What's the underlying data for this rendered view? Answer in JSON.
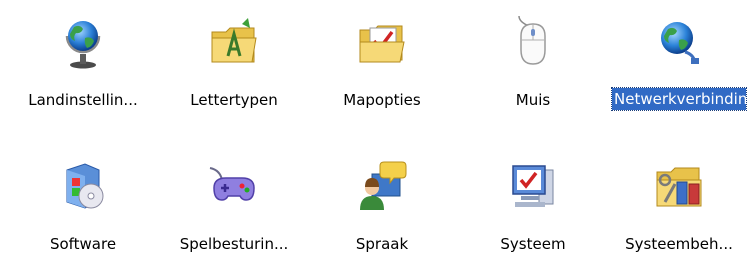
{
  "items": [
    {
      "label": "Landinstellin...",
      "icon": "globe-on-stand-icon"
    },
    {
      "label": "Lettertypen",
      "icon": "fonts-folder-icon"
    },
    {
      "label": "Mapopties",
      "icon": "folder-options-icon"
    },
    {
      "label": "Muis",
      "icon": "mouse-icon"
    },
    {
      "label": "Netwerkverbindingen",
      "icon": "network-globe-icon",
      "selected": true
    },
    {
      "label": "Software",
      "icon": "software-box-cd-icon"
    },
    {
      "label": "Spelbesturin...",
      "icon": "gamepad-icon"
    },
    {
      "label": "Spraak",
      "icon": "speech-person-icon"
    },
    {
      "label": "Systeem",
      "icon": "system-computer-icon"
    },
    {
      "label": "Systeembeh...",
      "icon": "admin-tools-folder-icon"
    }
  ],
  "colors": {
    "selection": "#316ac5",
    "selection_text": "#ffffff",
    "background": "#ffffff"
  }
}
